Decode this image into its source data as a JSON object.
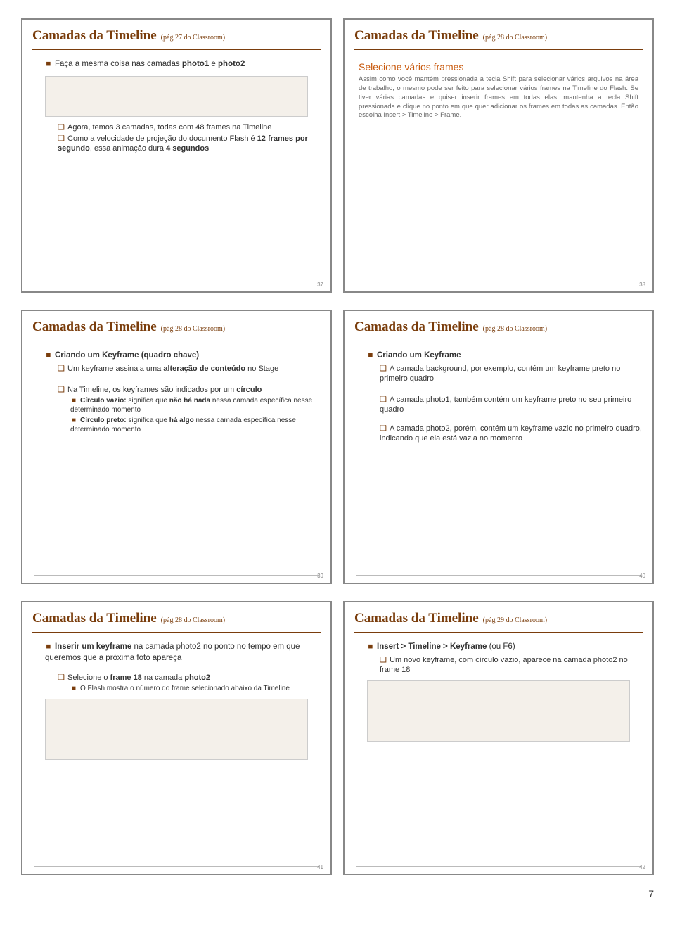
{
  "pageNumber": "7",
  "slides": [
    {
      "num": "37",
      "title": "Camadas da Timeline",
      "sub": "(pág 27 do Classroom)",
      "items": [
        {
          "lvl": 1,
          "text": "Faça a mesma coisa nas camadas photo1 e photo2",
          "bold": [
            "photo1",
            "photo2"
          ]
        },
        {
          "lvl": 0,
          "img": true,
          "cls": "img-placeholder"
        },
        {
          "lvl": 2,
          "text": "Agora, temos 3 camadas, todas com 48 frames na Timeline"
        },
        {
          "lvl": 2,
          "text": "Como a velocidade de projeção do documento Flash é 12 frames por segundo, essa animação dura 4 segundos",
          "bold": [
            "12 frames por segundo",
            "4 segundos"
          ]
        }
      ]
    },
    {
      "num": "38",
      "title": "Camadas da Timeline",
      "sub": "(pág 28 do Classroom)",
      "book": {
        "heading": "Selecione vários frames",
        "body": "Assim como você mantém pressionada a tecla Shift para selecionar vários arquivos na área de trabalho, o mesmo pode ser feito para selecionar vários frames na Timeline do Flash. Se tiver várias camadas e quiser inserir frames em todas elas, mantenha a tecla Shift pressionada e clique no ponto em que quer adicionar os frames em todas as camadas. Então escolha Insert > Timeline > Frame."
      }
    },
    {
      "num": "39",
      "title": "Camadas da Timeline",
      "sub": "(pág 28 do Classroom)",
      "items": [
        {
          "lvl": 1,
          "text": "Criando um Keyframe (quadro chave)",
          "bold": [
            "Criando um Keyframe (quadro chave)"
          ]
        },
        {
          "lvl": 2,
          "text": "Um keyframe assinala uma alteração de conteúdo no Stage",
          "bold": [
            "alteração de conteúdo"
          ]
        },
        {
          "lvl": 0,
          "sp": 12
        },
        {
          "lvl": 2,
          "text": "Na Timeline, os keyframes são indicados por um círculo",
          "bold": [
            "círculo"
          ]
        },
        {
          "lvl": 3,
          "text": "Círculo vazio: significa que não há nada nessa camada específica nesse determinado momento",
          "bold": [
            "Círculo vazio:",
            "não há nada"
          ]
        },
        {
          "lvl": 3,
          "text": "Círculo preto: significa que há algo nessa camada específica nesse determinado momento",
          "bold": [
            "Círculo preto:",
            "há algo"
          ]
        }
      ]
    },
    {
      "num": "40",
      "title": "Camadas da Timeline",
      "sub": "(pág 28 do Classroom)",
      "items": [
        {
          "lvl": 1,
          "text": "Criando um Keyframe",
          "bold": [
            "Criando um Keyframe"
          ]
        },
        {
          "lvl": 2,
          "text": "A camada background, por exemplo, contém um keyframe preto no primeiro quadro"
        },
        {
          "lvl": 0,
          "sp": 12
        },
        {
          "lvl": 2,
          "text": "A camada photo1, também contém um keyframe preto no seu primeiro quadro"
        },
        {
          "lvl": 0,
          "sp": 8
        },
        {
          "lvl": 2,
          "text": "A camada photo2, porém, contém um keyframe vazio no primeiro quadro, indicando que ela está vazia no momento"
        }
      ]
    },
    {
      "num": "41",
      "title": "Camadas da Timeline",
      "sub": "(pág 28 do Classroom)",
      "items": [
        {
          "lvl": 1,
          "text": "Inserir um keyframe na camada photo2 no ponto no tempo em que queremos que a próxima foto apareça",
          "bold": [
            "Inserir um keyframe"
          ]
        },
        {
          "lvl": 0,
          "sp": 8
        },
        {
          "lvl": 2,
          "text": "Selecione o frame 18 na camada photo2",
          "bold": [
            "frame 18",
            "photo2"
          ]
        },
        {
          "lvl": 3,
          "text": "O Flash mostra o número do frame selecionado abaixo da Timeline"
        },
        {
          "lvl": 0,
          "img": true,
          "cls": "img-placeholder med"
        }
      ]
    },
    {
      "num": "42",
      "title": "Camadas da Timeline",
      "sub": "(pág 29 do Classroom)",
      "items": [
        {
          "lvl": 1,
          "text": "Insert > Timeline > Keyframe (ou F6)",
          "bold": [
            "Insert > Timeline > Keyframe"
          ]
        },
        {
          "lvl": 2,
          "text": "Um novo keyframe, com círculo vazio, aparece na camada photo2 no frame 18"
        },
        {
          "lvl": 0,
          "img": true,
          "cls": "img-placeholder med"
        }
      ]
    }
  ]
}
